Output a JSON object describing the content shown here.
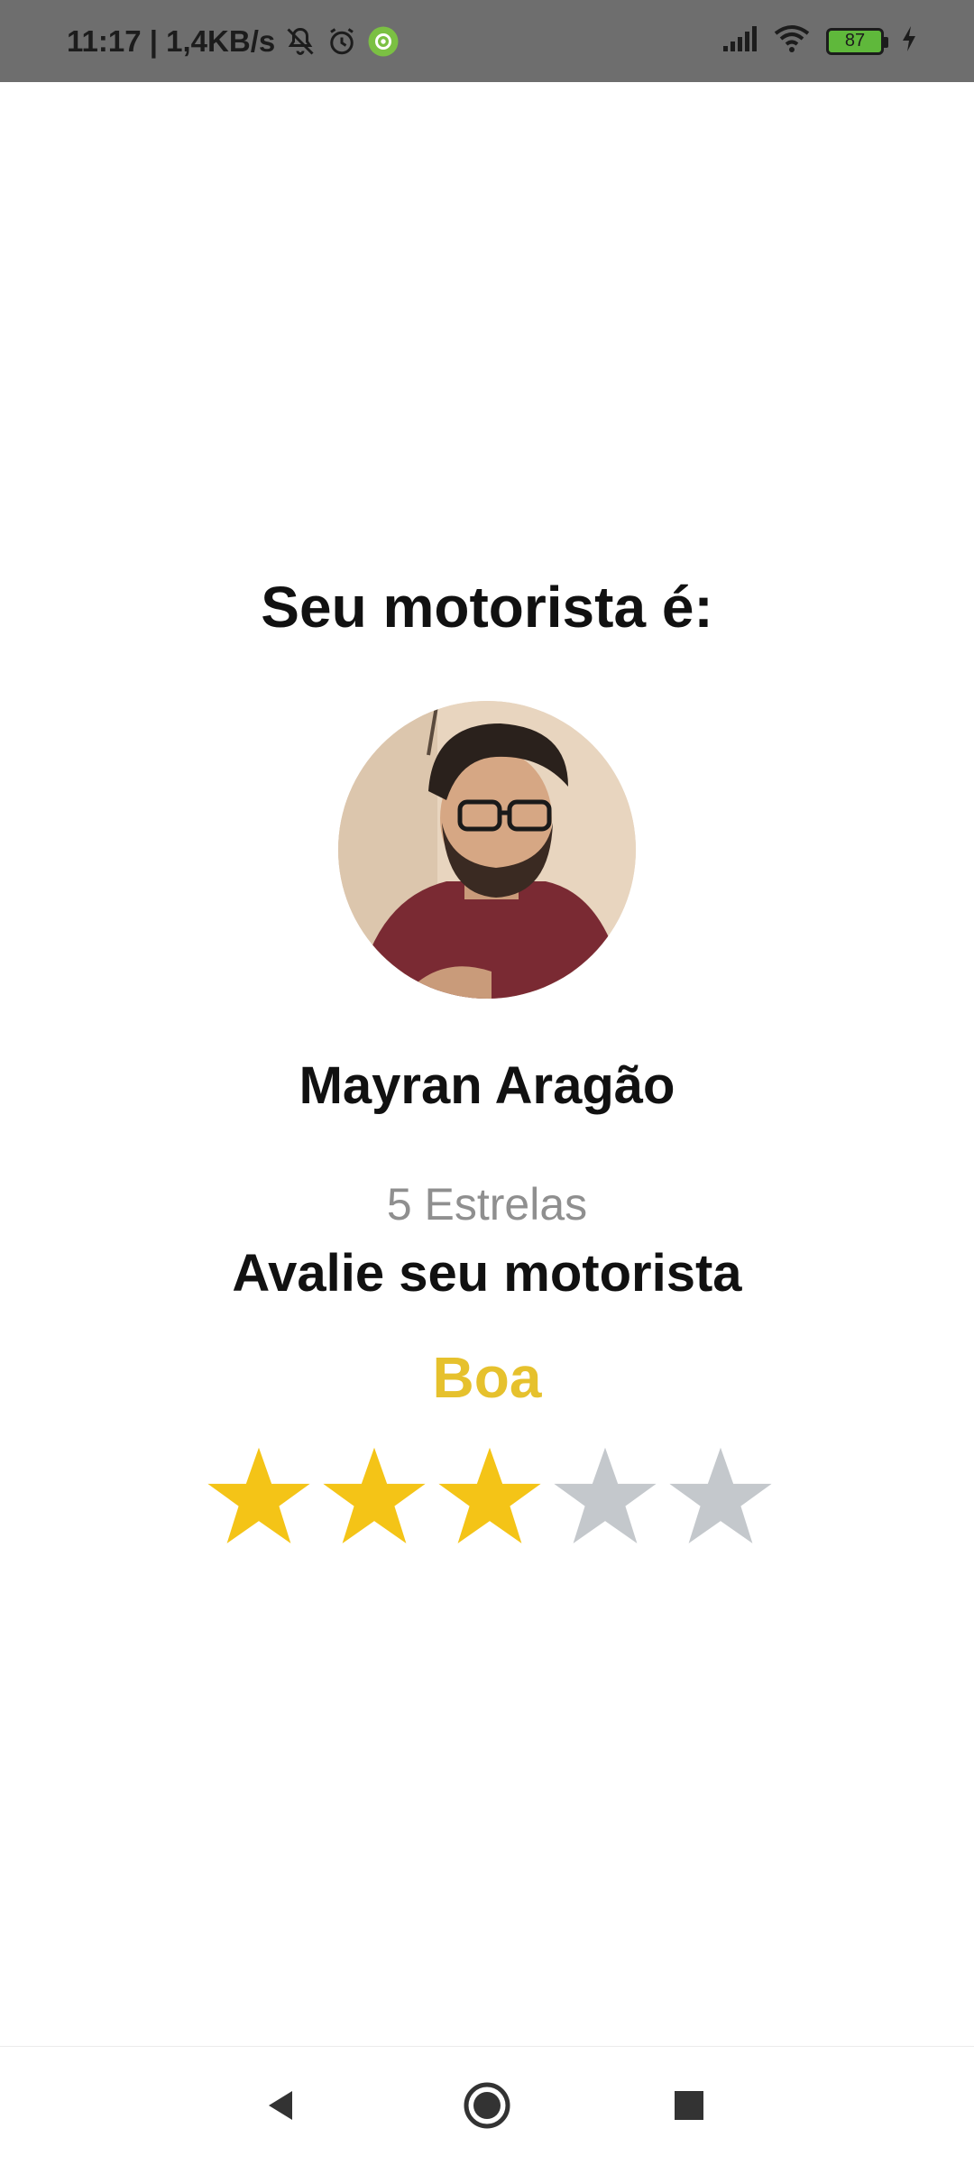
{
  "status_bar": {
    "time_speed": "11:17 | 1,4KB/s",
    "battery_level": "87",
    "icons": [
      "notifications-off-icon",
      "alarm-icon",
      "app-notification-icon",
      "signal-icon",
      "wifi-icon",
      "battery-icon",
      "charging-icon"
    ]
  },
  "main": {
    "title": "Seu motorista é:",
    "driver_name": "Mayran Aragão",
    "stars_text": "5 Estrelas",
    "rate_prompt": "Avalie seu motorista",
    "rating_label": "Boa",
    "rating": {
      "value": 3,
      "max": 5
    }
  },
  "colors": {
    "star_filled": "#f4c417",
    "star_empty": "#c4c8cc",
    "rating_label": "#e6c12d",
    "status_bar_bg": "#6e6e6e"
  },
  "nav_bar": {
    "icons": [
      "back-icon",
      "home-icon",
      "recents-icon"
    ]
  }
}
